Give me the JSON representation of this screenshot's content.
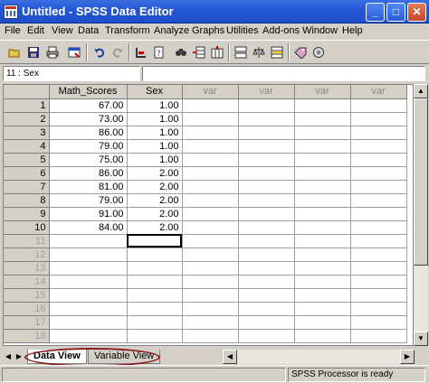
{
  "window": {
    "title": "Untitled - SPSS Data Editor",
    "min": "_",
    "max": "□",
    "close": "✕"
  },
  "menu": [
    "File",
    "Edit",
    "View",
    "Data",
    "Transform",
    "Analyze",
    "Graphs",
    "Utilities",
    "Add-ons",
    "Window",
    "Help"
  ],
  "toolbar": {
    "icons": [
      "open-icon",
      "save-icon",
      "print-icon",
      "dialog-recall-icon",
      "undo-icon",
      "redo-icon",
      "goto-case-icon",
      "variables-icon",
      "find-icon",
      "insert-case-icon",
      "insert-variable-icon",
      "split-file-icon",
      "weight-cases-icon",
      "select-cases-icon",
      "value-labels-icon",
      "use-sets-icon"
    ]
  },
  "cell_ref": "11 : Sex",
  "cell_value": "",
  "grid": {
    "columns": [
      "Math_Scores",
      "Sex",
      "var",
      "var",
      "var",
      "var"
    ],
    "rows": [
      {
        "n": "1",
        "math": "67.00",
        "sex": "1.00"
      },
      {
        "n": "2",
        "math": "73.00",
        "sex": "1.00"
      },
      {
        "n": "3",
        "math": "86.00",
        "sex": "1.00"
      },
      {
        "n": "4",
        "math": "79.00",
        "sex": "1.00"
      },
      {
        "n": "5",
        "math": "75.00",
        "sex": "1.00"
      },
      {
        "n": "6",
        "math": "86.00",
        "sex": "2.00"
      },
      {
        "n": "7",
        "math": "81.00",
        "sex": "2.00"
      },
      {
        "n": "8",
        "math": "79.00",
        "sex": "2.00"
      },
      {
        "n": "9",
        "math": "91.00",
        "sex": "2.00"
      },
      {
        "n": "10",
        "math": "84.00",
        "sex": "2.00"
      }
    ],
    "empty_rows": [
      "11",
      "12",
      "13",
      "14",
      "15",
      "16",
      "17",
      "18"
    ]
  },
  "tabs": {
    "data_view": "Data View",
    "variable_view": "Variable View"
  },
  "status": {
    "message": "SPSS Processor  is ready"
  },
  "colors": {
    "titlebar": "#2456d8",
    "highlight_oval": "#8b1a1a"
  }
}
